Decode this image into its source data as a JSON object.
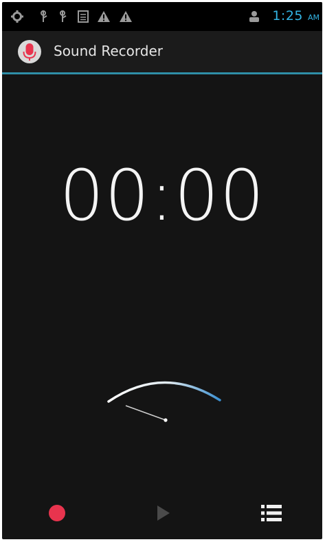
{
  "status_bar": {
    "time": "1:25",
    "ampm": "AM",
    "icons": [
      "settings-icon",
      "usb-icon",
      "usb-icon",
      "sd-card-icon",
      "warning-icon",
      "warning-icon",
      "account-icon"
    ]
  },
  "action_bar": {
    "title": "Sound Recorder",
    "icon": "microphone-icon"
  },
  "timer": {
    "value": "00:00"
  },
  "controls": {
    "record": "record-icon",
    "play": "play-icon",
    "list": "list-icon"
  },
  "colors": {
    "accent": "#33b5e5",
    "record": "#e8344e",
    "background": "#141414"
  }
}
